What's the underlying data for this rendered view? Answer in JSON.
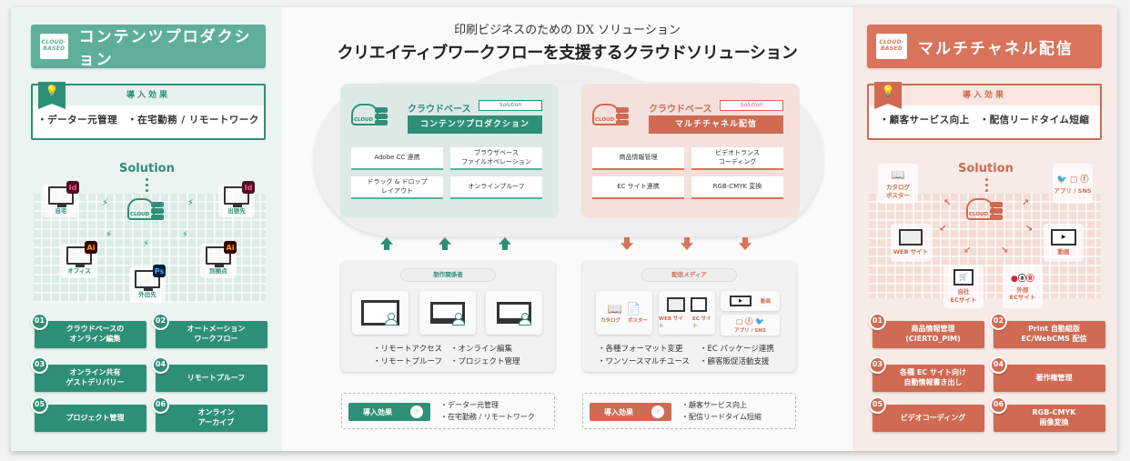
{
  "header": {
    "subtitle": "印刷ビジネスのための DX ソリューション",
    "title": "クリエイティブワークフローを支援するクラウドソリューション"
  },
  "colors": {
    "green": "#2e8f78",
    "green_light": "#5fae9c",
    "red": "#d06a52",
    "red_light": "#d9735b"
  },
  "left": {
    "badge": [
      "CLOUD-",
      "BASED"
    ],
    "title": "コンテンツプロダクション",
    "effect": {
      "heading": "導入効果",
      "icon": "lightbulb-icon",
      "text": "・データー元管理　・在宅勤務 / リモートワーク"
    },
    "solution_label": "Solution",
    "cloud_label": "CLOUD",
    "nodes": [
      {
        "label": "自宅",
        "app": "Id"
      },
      {
        "label": "出張先",
        "app": "Id"
      },
      {
        "label": "オフィス",
        "app": "Ai"
      },
      {
        "label": "別拠点",
        "app": "Ai"
      },
      {
        "label": "外出先",
        "app": "Ps"
      }
    ],
    "features": [
      {
        "num": "01",
        "label": "クラウドベースの\nオンライン編集"
      },
      {
        "num": "02",
        "label": "オートメーション\nワークフロー"
      },
      {
        "num": "03",
        "label": "オンライン共有\nゲストデリバリー"
      },
      {
        "num": "04",
        "label": "リモートプルーフ"
      },
      {
        "num": "05",
        "label": "プロジェクト管理"
      },
      {
        "num": "06",
        "label": "オンライン\nアーカイブ"
      }
    ]
  },
  "right": {
    "badge": [
      "CLOUD-",
      "BASED"
    ],
    "title": "マルチチャネル配信",
    "effect": {
      "heading": "導入効果",
      "icon": "lightbulb-icon",
      "text": "・顧客サービス向上　・配信リードタイム短縮"
    },
    "solution_label": "Solution",
    "cloud_label": "CLOUD",
    "nodes": [
      {
        "label": "カタログ\nポスター"
      },
      {
        "label": "アプリ / SNS"
      },
      {
        "label": "WEB サイト"
      },
      {
        "label": "動画"
      },
      {
        "label": "自社\nECサイト"
      },
      {
        "label": "外部\nECサイト"
      }
    ],
    "features": [
      {
        "num": "01",
        "label": "商品情報管理\n(CIERTO_PIM)"
      },
      {
        "num": "02",
        "label": "Print 自動組版\nEC/WebCMS 配信"
      },
      {
        "num": "03",
        "label": "各種 EC サイト向け\n自動情報書き出し"
      },
      {
        "num": "04",
        "label": "著作権管理"
      },
      {
        "num": "05",
        "label": "ビデオコーディング"
      },
      {
        "num": "06",
        "label": "RGB-CMYK\n画像変換"
      }
    ]
  },
  "center": {
    "green_card": {
      "kicker": "クラウドベース",
      "solution_tag": "Solution",
      "name": "コンテンツプロダクション",
      "cloud_label": "CLOUD",
      "items": [
        "Adobe CC 連携",
        "ブラウザベース\nファイルオペレーション",
        "ドラッグ & ドロップ\nレイアウト",
        "オンラインプルーフ"
      ]
    },
    "red_card": {
      "kicker": "クラウドベース",
      "solution_tag": "Solution",
      "name": "マルチチャネル配信",
      "cloud_label": "CLOUD",
      "items": [
        "商品情報管理",
        "ビデオトランス\nコーディング",
        "EC サイト連携",
        "RGB-CMYK 変換"
      ]
    },
    "producers": {
      "pill": "制作関係者",
      "bullets": [
        "・リモートアクセス",
        "・オンライン編集",
        "・リモートプルーフ",
        "・プロジェクト管理"
      ]
    },
    "media": {
      "pill": "配信メディア",
      "labels": {
        "catalog": "カタログ",
        "poster": "ポスター",
        "web": "WEB サイト",
        "ec": "EC サイト",
        "video": "動画",
        "sns": "アプリ / SNS"
      },
      "bullets": [
        "・各種フォーマット変更",
        "・EC パッケージ連携",
        "・ワンソースマルチユース",
        "・顧客販促活動支援"
      ]
    },
    "green_effect": {
      "label": "導入効果",
      "lines": [
        "・データー元管理",
        "・在宅勤務 / リモートワーク"
      ]
    },
    "red_effect": {
      "label": "導入効果",
      "lines": [
        "・顧客サービス向上",
        "・配信リードタイム短縮"
      ]
    }
  }
}
